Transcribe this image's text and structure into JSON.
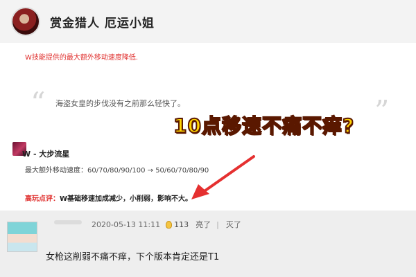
{
  "header": {
    "title": "赏金猎人 厄运小姐"
  },
  "red_note": "W技能提供的最大额外移动速度降低.",
  "quote": {
    "open_mark": "“",
    "text": "海盗女皇的步伐没有之前那么轻快了。",
    "close_mark": "”"
  },
  "overlay_text": "10点移速不痛不痒?",
  "skill": {
    "name": "W - 大步流星",
    "detail": "最大额外移动速度：60/70/80/90/100 → 50/60/70/80/90"
  },
  "review": {
    "label": "高玩点评：",
    "text": "W基础移速加成减少，小削弱，影响不大。"
  },
  "comment": {
    "timestamp": "2020-05-13 11:11",
    "like_count": "113",
    "action_like": "亮了",
    "separator": "|",
    "action_dislike": "灭了",
    "text": "女枪这削弱不痛不痒，下个版本肯定还是T1"
  },
  "colors": {
    "accent_red": "#e0312f",
    "overlay_yellow": "#ffd400",
    "arrow_red": "#e53030"
  },
  "icons": {
    "champion_avatar": "champion-portrait-icon",
    "skill_icon": "skill-w-icon",
    "like_icon": "lightbulb-icon",
    "user_avatar": "user-avatar-icon"
  }
}
